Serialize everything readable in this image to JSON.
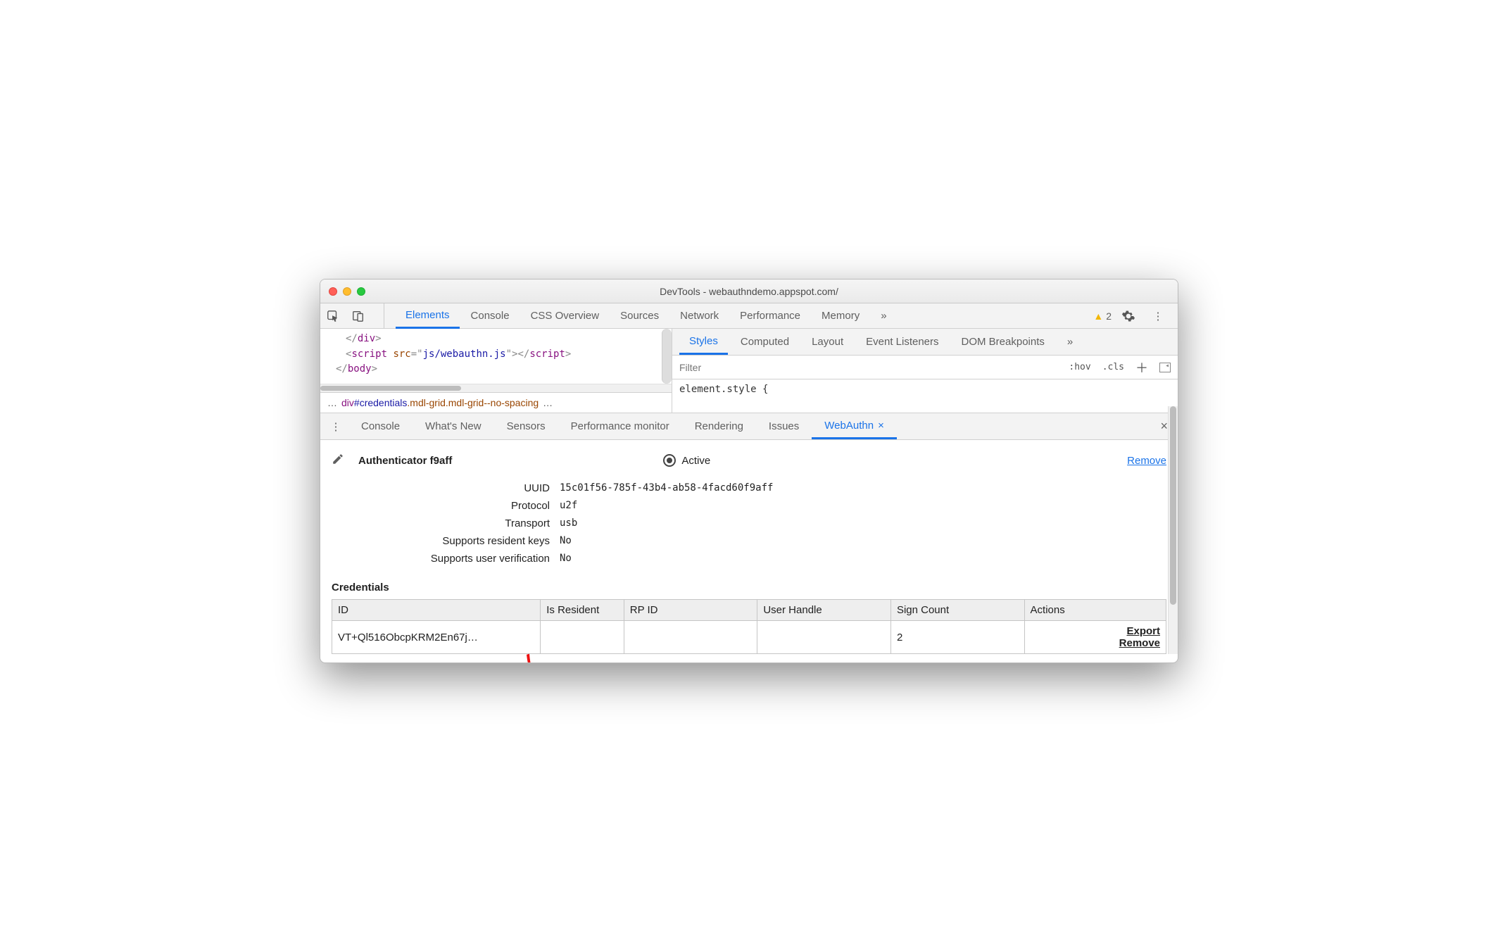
{
  "window_title": "DevTools - webauthndemo.appspot.com/",
  "main_tabs": {
    "elements": "Elements",
    "console": "Console",
    "css_overview": "CSS Overview",
    "sources": "Sources",
    "network": "Network",
    "performance": "Performance",
    "memory": "Memory",
    "more": "»"
  },
  "warning_count": "2",
  "code": {
    "l1a": "</",
    "l1b": "div",
    "l1c": ">",
    "l2a": "<",
    "l2b": "script",
    "l2c": " src",
    "l2d": "=\"",
    "l2e": "js/webauthn.js",
    "l2f": "\"></",
    "l2g": "script",
    "l2h": ">",
    "l3a": "</",
    "l3b": "body",
    "l3c": ">"
  },
  "breadcrumb": {
    "ell1": "…",
    "p1": "div",
    "p2": "#credentials",
    "p3": ".mdl-grid",
    "p4": ".mdl-grid--no-spacing",
    "ell2": "…"
  },
  "styles_tabs": {
    "styles": "Styles",
    "computed": "Computed",
    "layout": "Layout",
    "event_listeners": "Event Listeners",
    "dom_breakpoints": "DOM Breakpoints",
    "more": "»"
  },
  "filter_placeholder": "Filter",
  "filter_tools": {
    "hov": ":hov",
    "cls": ".cls"
  },
  "element_style": "element.style {",
  "drawer_tabs": {
    "console": "Console",
    "whats_new": "What's New",
    "sensors": "Sensors",
    "perf_monitor": "Performance monitor",
    "rendering": "Rendering",
    "issues": "Issues",
    "webauthn": "WebAuthn"
  },
  "authenticator": {
    "name": "Authenticator f9aff",
    "active": "Active",
    "remove": "Remove",
    "props": {
      "uuid_label": "UUID",
      "uuid": "15c01f56-785f-43b4-ab58-4facd60f9aff",
      "protocol_label": "Protocol",
      "protocol": "u2f",
      "transport_label": "Transport",
      "transport": "usb",
      "resident_label": "Supports resident keys",
      "resident": "No",
      "verify_label": "Supports user verification",
      "verify": "No"
    }
  },
  "credentials": {
    "title": "Credentials",
    "headers": {
      "id": "ID",
      "is_resident": "Is Resident",
      "rp_id": "RP ID",
      "user_handle": "User Handle",
      "sign_count": "Sign Count",
      "actions": "Actions"
    },
    "row": {
      "id": "VT+Ql516ObcpKRM2En67j…",
      "is_resident": "",
      "rp_id": "",
      "user_handle": "",
      "sign_count": "2",
      "export": "Export",
      "remove": "Remove"
    }
  }
}
